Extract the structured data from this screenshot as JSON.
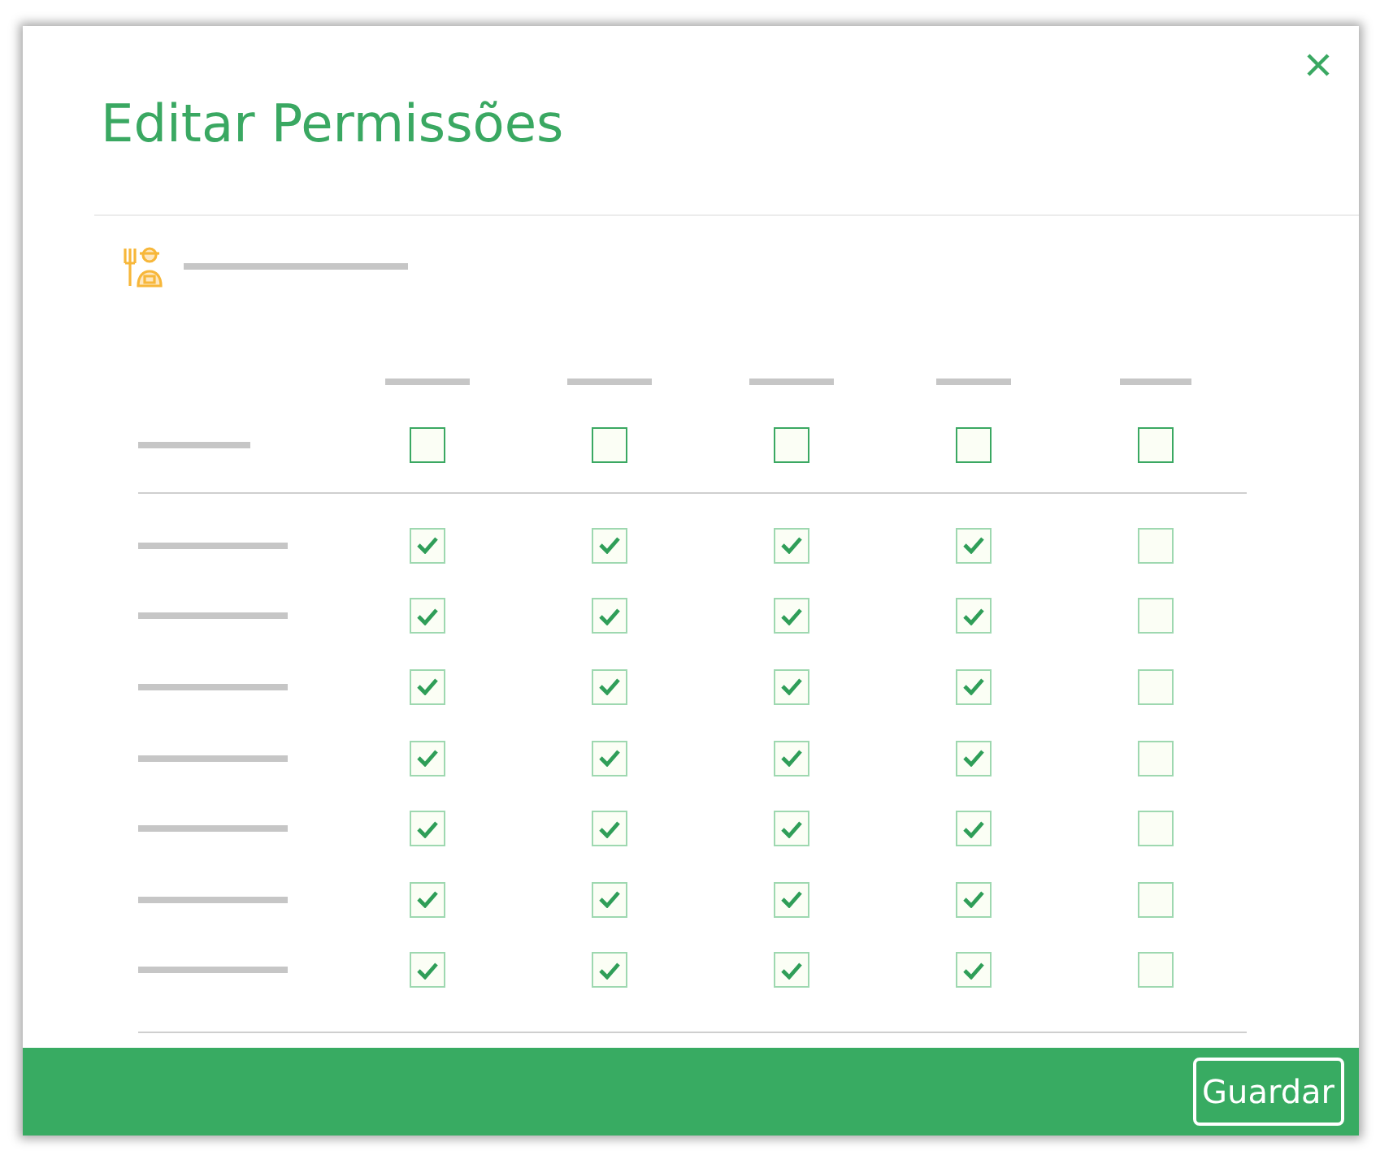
{
  "dialog": {
    "title": "Editar Permissões"
  },
  "table": {
    "header_checks": [
      {
        "checked": false
      },
      {
        "checked": false
      },
      {
        "checked": false
      },
      {
        "checked": false
      },
      {
        "checked": false
      }
    ],
    "rows": [
      {
        "checks": [
          {
            "checked": true
          },
          {
            "checked": true
          },
          {
            "checked": true
          },
          {
            "checked": true
          },
          {
            "checked": false
          }
        ]
      },
      {
        "checks": [
          {
            "checked": true
          },
          {
            "checked": true
          },
          {
            "checked": true
          },
          {
            "checked": true
          },
          {
            "checked": false
          }
        ]
      },
      {
        "checks": [
          {
            "checked": true
          },
          {
            "checked": true
          },
          {
            "checked": true
          },
          {
            "checked": true
          },
          {
            "checked": false
          }
        ]
      },
      {
        "checks": [
          {
            "checked": true
          },
          {
            "checked": true
          },
          {
            "checked": true
          },
          {
            "checked": true
          },
          {
            "checked": false
          }
        ]
      },
      {
        "checks": [
          {
            "checked": true
          },
          {
            "checked": true
          },
          {
            "checked": true
          },
          {
            "checked": true
          },
          {
            "checked": false
          }
        ]
      },
      {
        "checks": [
          {
            "checked": true
          },
          {
            "checked": true
          },
          {
            "checked": true
          },
          {
            "checked": true
          },
          {
            "checked": false
          }
        ]
      },
      {
        "checks": [
          {
            "checked": true
          },
          {
            "checked": true
          },
          {
            "checked": true
          },
          {
            "checked": true
          },
          {
            "checked": false
          }
        ]
      }
    ]
  },
  "footer": {
    "button": "Guardar"
  }
}
